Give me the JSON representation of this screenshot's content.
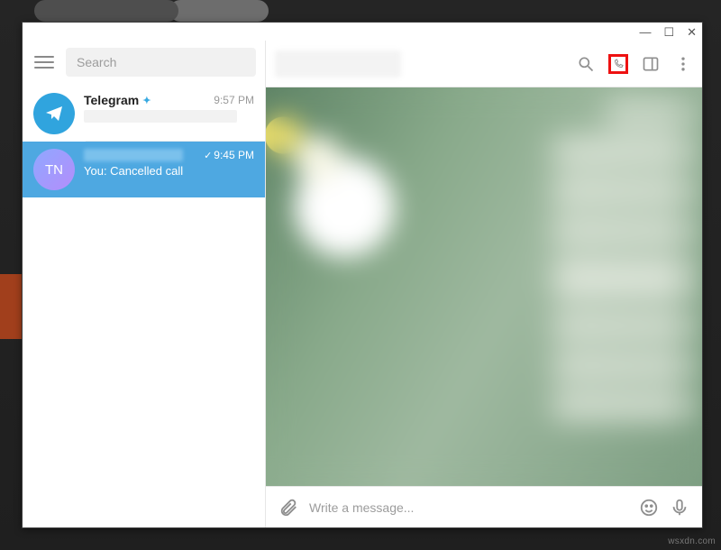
{
  "window_controls": {
    "min": "—",
    "max": "☐",
    "close": "✕"
  },
  "sidebar": {
    "search_placeholder": "Search",
    "items": [
      {
        "name": "Telegram",
        "time": "9:57 PM",
        "verified": true
      },
      {
        "initials": "TN",
        "time": "9:45 PM",
        "message": "You: Cancelled call",
        "checked": true,
        "selected": true
      }
    ]
  },
  "composer": {
    "placeholder": "Write a message..."
  },
  "icons": {
    "menu": "menu-icon",
    "search": "search-icon",
    "call": "phone-icon",
    "panel": "side-panel-icon",
    "more": "more-vertical-icon",
    "attach": "paperclip-icon",
    "emoji": "smile-icon",
    "mic": "microphone-icon",
    "plane": "paper-plane-icon"
  },
  "watermark": "wsxdn.com"
}
